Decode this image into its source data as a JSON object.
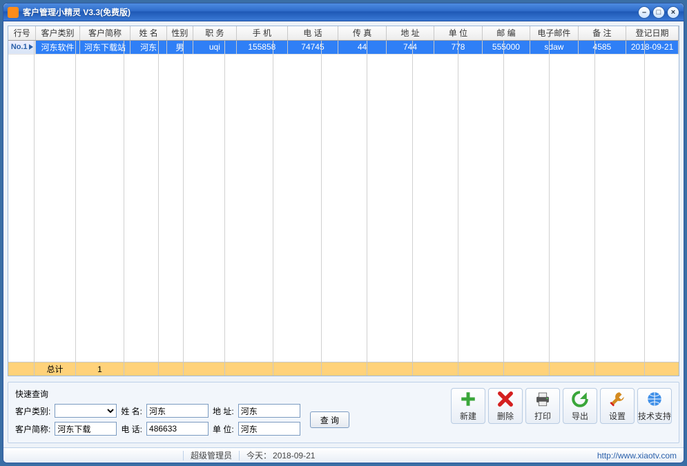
{
  "window": {
    "title": "客户管理小精灵 V3.3(免费版)"
  },
  "columns": [
    {
      "key": "rownum",
      "label": "行号",
      "w": 38
    },
    {
      "key": "cat",
      "label": "客户类别",
      "w": 60
    },
    {
      "key": "short",
      "label": "客户简称",
      "w": 70
    },
    {
      "key": "name",
      "label": "姓 名",
      "w": 50
    },
    {
      "key": "sex",
      "label": "性别",
      "w": 36
    },
    {
      "key": "job",
      "label": "职 务",
      "w": 60
    },
    {
      "key": "mobile",
      "label": "手 机",
      "w": 70
    },
    {
      "key": "phone",
      "label": "电 话",
      "w": 70
    },
    {
      "key": "fax",
      "label": "传 真",
      "w": 66
    },
    {
      "key": "addr",
      "label": "地 址",
      "w": 66
    },
    {
      "key": "company",
      "label": "单 位",
      "w": 66
    },
    {
      "key": "zip",
      "label": "邮 编",
      "w": 66
    },
    {
      "key": "email",
      "label": "电子邮件",
      "w": 66
    },
    {
      "key": "note",
      "label": "备 注",
      "w": 66
    },
    {
      "key": "date",
      "label": "登记日期",
      "w": 72
    }
  ],
  "rows": [
    {
      "rownum": "No.1",
      "cat": "河东软件",
      "short": "河东下载站",
      "name": "河东",
      "sex": "男",
      "job": "uqi",
      "mobile": "155858",
      "phone": "74745",
      "fax": "44",
      "addr": "744",
      "company": "778",
      "zip": "555000",
      "email": "sdaw",
      "note": "4585",
      "date": "2018-09-21",
      "selected": true
    }
  ],
  "totals": {
    "label": "总计",
    "count": "1"
  },
  "search": {
    "title": "快速查询",
    "labels": {
      "cat": "客户类别:",
      "name": "姓 名:",
      "addr": "地 址:",
      "short": "客户简称:",
      "phone": "电 话:",
      "company": "单 位:"
    },
    "values": {
      "cat": "",
      "name": "河东",
      "addr": "河东",
      "short": "河东下载",
      "phone": "486633",
      "company": "河东"
    },
    "button": "查 询"
  },
  "actions": {
    "new": "新建",
    "delete": "删除",
    "print": "打印",
    "export": "导出",
    "settings": "设置",
    "support": "技术支持"
  },
  "status": {
    "user": "超级管理员",
    "today_label": "今天：",
    "today": "2018-09-21",
    "url": "http://www.xiaotv.com"
  }
}
